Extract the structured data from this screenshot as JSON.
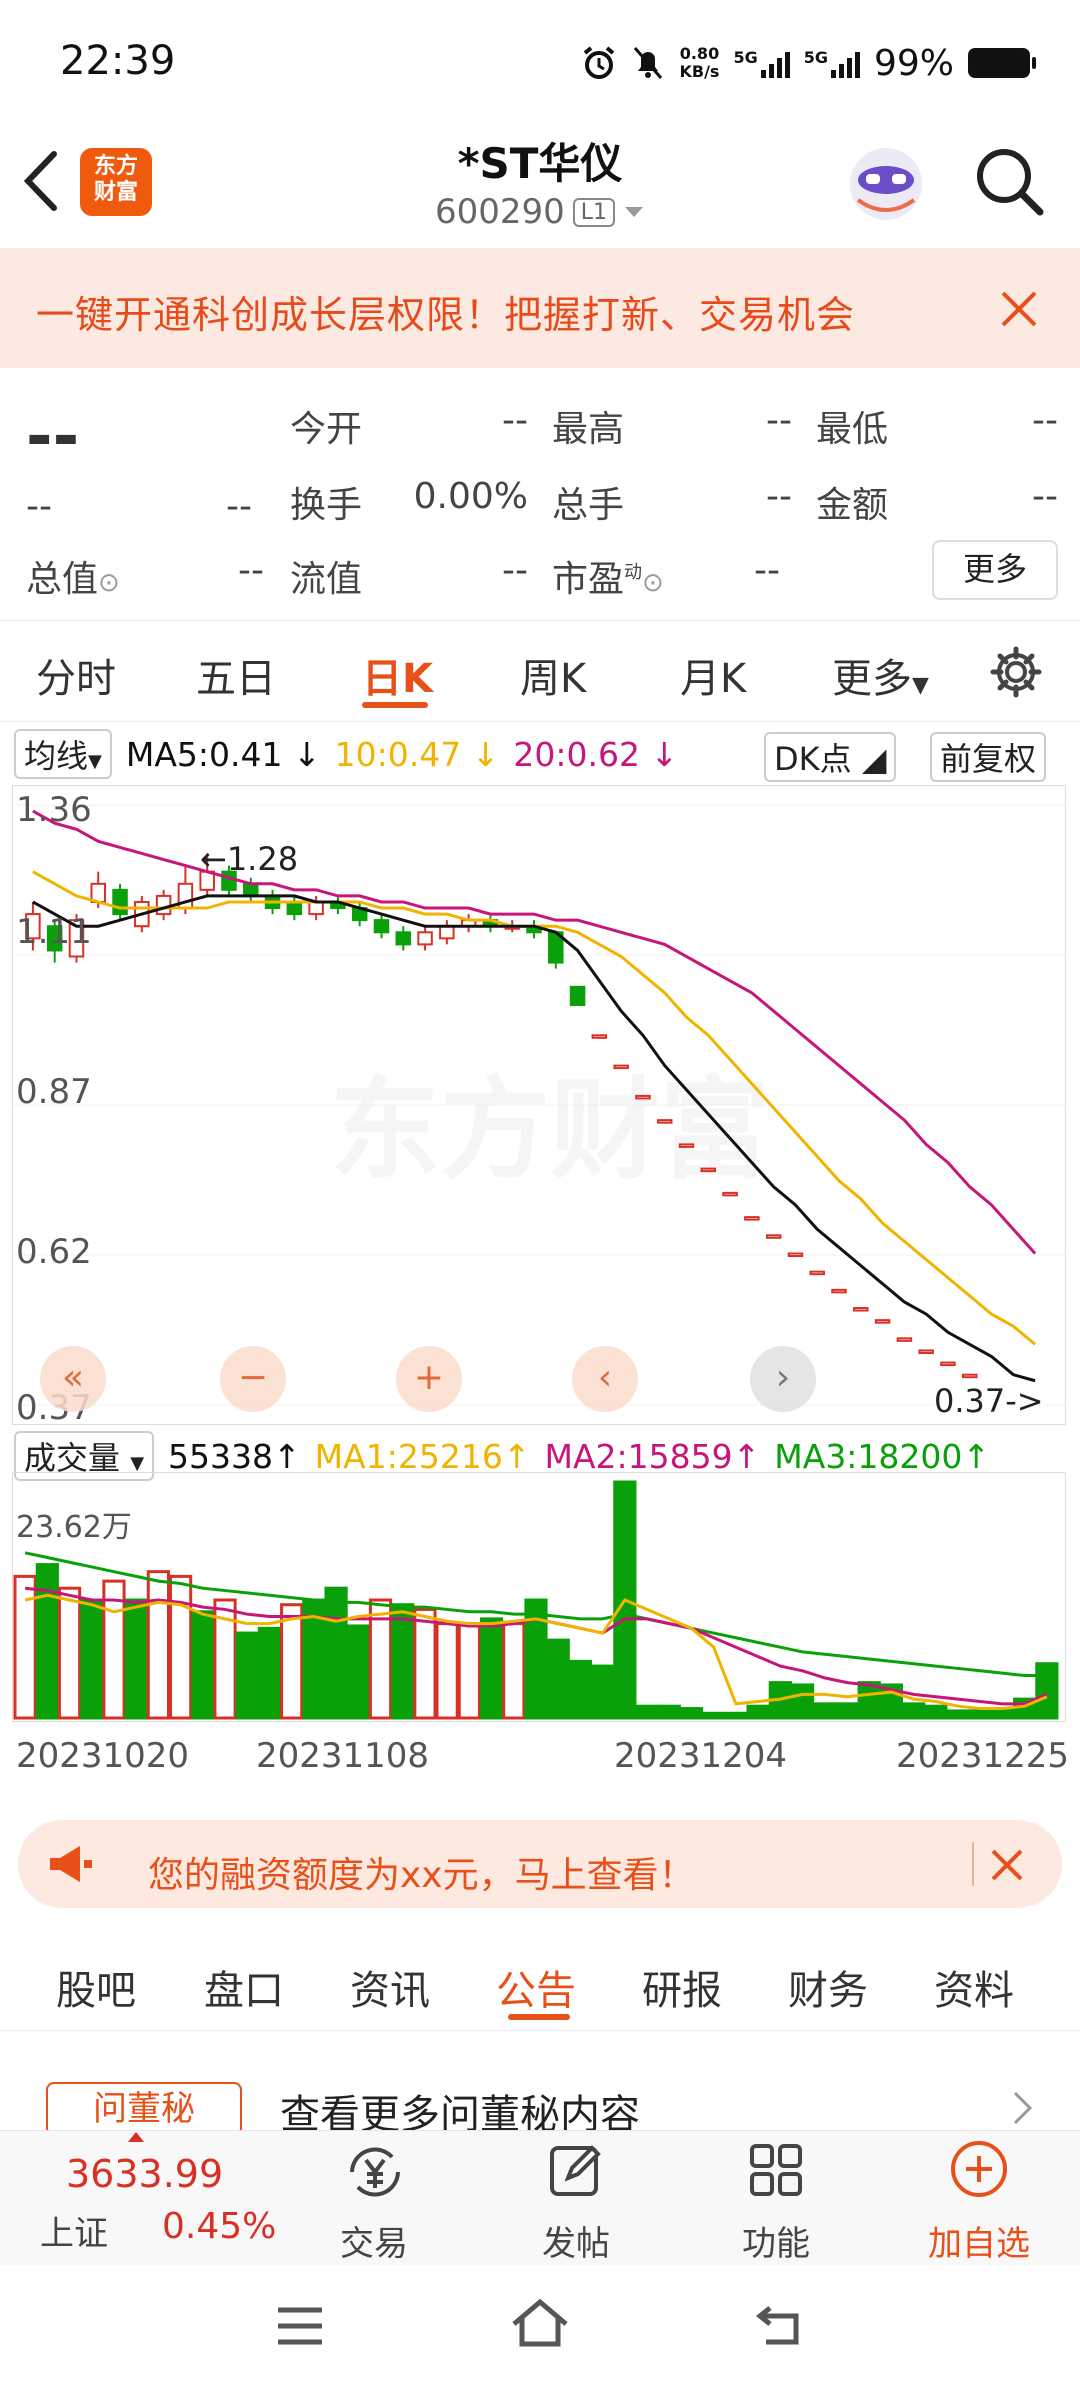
{
  "status": {
    "time": "22:39",
    "net_speed": "0.80",
    "net_unit": "KB/s",
    "sig1": "5G",
    "sig2": "5G",
    "battery": "99%"
  },
  "header": {
    "logo_line1": "东方",
    "logo_line2": "财富",
    "title": "*ST华仪",
    "code": "600290",
    "level": "L1"
  },
  "banner": {
    "text": "一键开通科创成长层权限！把握打新、交易机会"
  },
  "quote": {
    "price": "--",
    "change": "--",
    "change_pct": "--",
    "open_label": "今开",
    "open": "--",
    "high_label": "最高",
    "high": "--",
    "low_label": "最低",
    "low": "--",
    "turnover_label": "换手",
    "turnover": "0.00%",
    "volume_label": "总手",
    "volume": "--",
    "amount_label": "金额",
    "amount": "--",
    "total_value_label": "总值",
    "total_value": "--",
    "float_value_label": "流值",
    "float_value": "--",
    "pe_label": "市盈",
    "pe_sup": "动",
    "pe": "--",
    "more": "更多"
  },
  "tabs": [
    "分时",
    "五日",
    "日K",
    "周K",
    "月K",
    "更多"
  ],
  "active_tab": "日K",
  "indicators": {
    "ma_select": "均线",
    "ma5": "MA5:0.41",
    "ma10": "10:0.47",
    "ma20": "20:0.62",
    "dk": "DK点",
    "adjust": "前复权"
  },
  "price_axis": [
    "1.36",
    "1.11",
    "0.87",
    "0.62",
    "0.37"
  ],
  "annotations": {
    "high_mark": "1.28",
    "low_mark": "0.37"
  },
  "chart_nav": {
    "first": "«",
    "zoom_out": "−",
    "zoom_in": "+",
    "prev": "‹",
    "next": "›"
  },
  "volume": {
    "select": "成交量",
    "value": "55338",
    "ma1": "MA1:25216",
    "ma2": "MA2:15859",
    "ma3": "MA3:18200",
    "max_label": "23.62万"
  },
  "dates": [
    "20231020",
    "20231108",
    "20231204",
    "20231225"
  ],
  "colors": {
    "up": "#d93025",
    "down": "#0aa00a",
    "ma5": "#111111",
    "ma10": "#f0b400",
    "ma20": "#c8157a",
    "accent": "#e8501a"
  },
  "chart_data": {
    "type": "candlestick",
    "ylim": [
      0.37,
      1.36
    ],
    "candles": [
      {
        "o": 1.14,
        "c": 1.18,
        "h": 1.2,
        "l": 1.12
      },
      {
        "o": 1.16,
        "c": 1.12,
        "h": 1.17,
        "l": 1.1
      },
      {
        "o": 1.11,
        "c": 1.17,
        "h": 1.18,
        "l": 1.1
      },
      {
        "o": 1.2,
        "c": 1.23,
        "h": 1.25,
        "l": 1.19
      },
      {
        "o": 1.22,
        "c": 1.18,
        "h": 1.23,
        "l": 1.17
      },
      {
        "o": 1.16,
        "c": 1.2,
        "h": 1.21,
        "l": 1.15
      },
      {
        "o": 1.18,
        "c": 1.21,
        "h": 1.22,
        "l": 1.17
      },
      {
        "o": 1.19,
        "c": 1.23,
        "h": 1.26,
        "l": 1.18
      },
      {
        "o": 1.22,
        "c": 1.25,
        "h": 1.28,
        "l": 1.21
      },
      {
        "o": 1.25,
        "c": 1.22,
        "h": 1.26,
        "l": 1.21
      },
      {
        "o": 1.23,
        "c": 1.21,
        "h": 1.24,
        "l": 1.2
      },
      {
        "o": 1.21,
        "c": 1.19,
        "h": 1.22,
        "l": 1.18
      },
      {
        "o": 1.2,
        "c": 1.18,
        "h": 1.21,
        "l": 1.17
      },
      {
        "o": 1.18,
        "c": 1.2,
        "h": 1.21,
        "l": 1.17
      },
      {
        "o": 1.2,
        "c": 1.19,
        "h": 1.21,
        "l": 1.18
      },
      {
        "o": 1.19,
        "c": 1.17,
        "h": 1.2,
        "l": 1.16
      },
      {
        "o": 1.17,
        "c": 1.15,
        "h": 1.18,
        "l": 1.14
      },
      {
        "o": 1.15,
        "c": 1.13,
        "h": 1.16,
        "l": 1.12
      },
      {
        "o": 1.13,
        "c": 1.15,
        "h": 1.16,
        "l": 1.12
      },
      {
        "o": 1.14,
        "c": 1.16,
        "h": 1.17,
        "l": 1.13
      },
      {
        "o": 1.16,
        "c": 1.17,
        "h": 1.18,
        "l": 1.15
      },
      {
        "o": 1.17,
        "c": 1.16,
        "h": 1.18,
        "l": 1.15
      },
      {
        "o": 1.16,
        "c": 1.16,
        "h": 1.17,
        "l": 1.15
      },
      {
        "o": 1.16,
        "c": 1.15,
        "h": 1.17,
        "l": 1.14
      },
      {
        "o": 1.15,
        "c": 1.1,
        "h": 1.15,
        "l": 1.09
      },
      {
        "o": 1.06,
        "c": 1.03,
        "h": 1.06,
        "l": 1.03
      },
      {
        "o": 0.98,
        "c": 0.98,
        "h": 0.98,
        "l": 0.98
      },
      {
        "o": 0.93,
        "c": 0.93,
        "h": 0.93,
        "l": 0.93
      },
      {
        "o": 0.88,
        "c": 0.88,
        "h": 0.88,
        "l": 0.88
      },
      {
        "o": 0.84,
        "c": 0.84,
        "h": 0.84,
        "l": 0.84
      },
      {
        "o": 0.8,
        "c": 0.8,
        "h": 0.8,
        "l": 0.8
      },
      {
        "o": 0.76,
        "c": 0.76,
        "h": 0.76,
        "l": 0.76
      },
      {
        "o": 0.72,
        "c": 0.72,
        "h": 0.72,
        "l": 0.72
      },
      {
        "o": 0.68,
        "c": 0.68,
        "h": 0.68,
        "l": 0.68
      },
      {
        "o": 0.65,
        "c": 0.65,
        "h": 0.65,
        "l": 0.65
      },
      {
        "o": 0.62,
        "c": 0.62,
        "h": 0.62,
        "l": 0.62
      },
      {
        "o": 0.59,
        "c": 0.59,
        "h": 0.59,
        "l": 0.59
      },
      {
        "o": 0.56,
        "c": 0.56,
        "h": 0.56,
        "l": 0.56
      },
      {
        "o": 0.53,
        "c": 0.53,
        "h": 0.53,
        "l": 0.53
      },
      {
        "o": 0.51,
        "c": 0.51,
        "h": 0.51,
        "l": 0.51
      },
      {
        "o": 0.48,
        "c": 0.48,
        "h": 0.48,
        "l": 0.48
      },
      {
        "o": 0.46,
        "c": 0.46,
        "h": 0.46,
        "l": 0.46
      },
      {
        "o": 0.44,
        "c": 0.44,
        "h": 0.44,
        "l": 0.44
      },
      {
        "o": 0.42,
        "c": 0.42,
        "h": 0.42,
        "l": 0.42
      },
      {
        "o": 0.4,
        "c": 0.4,
        "h": 0.4,
        "l": 0.4
      },
      {
        "o": 0.38,
        "c": 0.38,
        "h": 0.38,
        "l": 0.38
      },
      {
        "o": 0.37,
        "c": 0.37,
        "h": 0.37,
        "l": 0.37
      }
    ],
    "ma5": [
      1.2,
      1.18,
      1.16,
      1.16,
      1.17,
      1.18,
      1.19,
      1.2,
      1.21,
      1.21,
      1.21,
      1.21,
      1.21,
      1.2,
      1.2,
      1.19,
      1.18,
      1.17,
      1.16,
      1.16,
      1.16,
      1.16,
      1.16,
      1.16,
      1.15,
      1.12,
      1.07,
      1.02,
      0.98,
      0.93,
      0.89,
      0.85,
      0.81,
      0.77,
      0.73,
      0.7,
      0.66,
      0.63,
      0.6,
      0.57,
      0.54,
      0.52,
      0.49,
      0.47,
      0.45,
      0.42,
      0.41
    ],
    "ma10": [
      1.25,
      1.23,
      1.21,
      1.2,
      1.19,
      1.19,
      1.19,
      1.19,
      1.19,
      1.2,
      1.2,
      1.2,
      1.2,
      1.2,
      1.2,
      1.2,
      1.19,
      1.19,
      1.18,
      1.18,
      1.17,
      1.17,
      1.16,
      1.16,
      1.16,
      1.15,
      1.13,
      1.11,
      1.08,
      1.05,
      1.01,
      0.98,
      0.94,
      0.9,
      0.86,
      0.82,
      0.78,
      0.74,
      0.71,
      0.67,
      0.64,
      0.61,
      0.58,
      0.55,
      0.52,
      0.5,
      0.47
    ],
    "ma20": [
      1.35,
      1.33,
      1.32,
      1.3,
      1.29,
      1.28,
      1.27,
      1.26,
      1.25,
      1.24,
      1.23,
      1.23,
      1.22,
      1.22,
      1.21,
      1.21,
      1.2,
      1.2,
      1.19,
      1.19,
      1.19,
      1.18,
      1.18,
      1.18,
      1.17,
      1.17,
      1.16,
      1.15,
      1.14,
      1.13,
      1.11,
      1.09,
      1.07,
      1.05,
      1.02,
      0.99,
      0.96,
      0.93,
      0.9,
      0.87,
      0.84,
      0.8,
      0.77,
      0.73,
      0.7,
      0.66,
      0.62
    ],
    "volumes": [
      0.6,
      0.65,
      0.55,
      0.5,
      0.58,
      0.5,
      0.62,
      0.6,
      0.45,
      0.5,
      0.36,
      0.38,
      0.48,
      0.5,
      0.55,
      0.39,
      0.5,
      0.48,
      0.46,
      0.4,
      0.4,
      0.42,
      0.4,
      0.5,
      0.33,
      0.24,
      0.22,
      1.0,
      0.05,
      0.05,
      0.04,
      0.02,
      0.02,
      0.05,
      0.15,
      0.14,
      0.06,
      0.06,
      0.15,
      0.14,
      0.06,
      0.05,
      0.03,
      0.03,
      0.04,
      0.08,
      0.23
    ],
    "vol_up": [
      true,
      false,
      true,
      false,
      true,
      false,
      true,
      true,
      false,
      true,
      false,
      false,
      true,
      false,
      false,
      false,
      true,
      false,
      true,
      true,
      true,
      false,
      true,
      false,
      false,
      false,
      false,
      false,
      false,
      false,
      false,
      false,
      false,
      false,
      false,
      false,
      false,
      false,
      false,
      false,
      false,
      false,
      false,
      false,
      false,
      false,
      false
    ],
    "vol_ma1": [
      0.5,
      0.52,
      0.5,
      0.48,
      0.45,
      0.47,
      0.49,
      0.48,
      0.44,
      0.42,
      0.4,
      0.4,
      0.42,
      0.43,
      0.41,
      0.43,
      0.44,
      0.45,
      0.43,
      0.41,
      0.4,
      0.4,
      0.41,
      0.42,
      0.4,
      0.38,
      0.36,
      0.5,
      0.46,
      0.42,
      0.38,
      0.3,
      0.06,
      0.07,
      0.08,
      0.1,
      0.1,
      0.09,
      0.1,
      0.11,
      0.08,
      0.07,
      0.05,
      0.04,
      0.04,
      0.05,
      0.09
    ],
    "vol_ma2": [
      0.55,
      0.54,
      0.52,
      0.5,
      0.5,
      0.49,
      0.5,
      0.49,
      0.47,
      0.46,
      0.44,
      0.43,
      0.43,
      0.43,
      0.42,
      0.42,
      0.42,
      0.42,
      0.41,
      0.4,
      0.39,
      0.39,
      0.4,
      0.42,
      0.4,
      0.38,
      0.36,
      0.42,
      0.42,
      0.4,
      0.38,
      0.34,
      0.3,
      0.26,
      0.22,
      0.2,
      0.17,
      0.15,
      0.14,
      0.12,
      0.1,
      0.09,
      0.08,
      0.07,
      0.06,
      0.06,
      0.1
    ],
    "vol_ma3": [
      0.7,
      0.68,
      0.66,
      0.64,
      0.62,
      0.6,
      0.58,
      0.57,
      0.55,
      0.54,
      0.53,
      0.52,
      0.51,
      0.5,
      0.49,
      0.49,
      0.48,
      0.47,
      0.47,
      0.46,
      0.45,
      0.45,
      0.44,
      0.44,
      0.43,
      0.42,
      0.42,
      0.44,
      0.42,
      0.4,
      0.38,
      0.36,
      0.34,
      0.32,
      0.3,
      0.28,
      0.27,
      0.26,
      0.25,
      0.24,
      0.23,
      0.22,
      0.21,
      0.2,
      0.19,
      0.18,
      0.18
    ]
  },
  "ad": {
    "text": "您的融资额度为xx元，马上查看！"
  },
  "bottom_tabs": [
    "股吧",
    "盘口",
    "资讯",
    "公告",
    "研报",
    "财务",
    "资料"
  ],
  "active_bottom_tab": "公告",
  "qdm": {
    "badge": "问董秘",
    "text": "查看更多问董秘内容"
  },
  "bottom_nav": {
    "index_value": "3633.99",
    "index_name": "上证",
    "index_pct": "0.45%",
    "trade": "交易",
    "post": "发帖",
    "func": "功能",
    "add": "加自选"
  }
}
